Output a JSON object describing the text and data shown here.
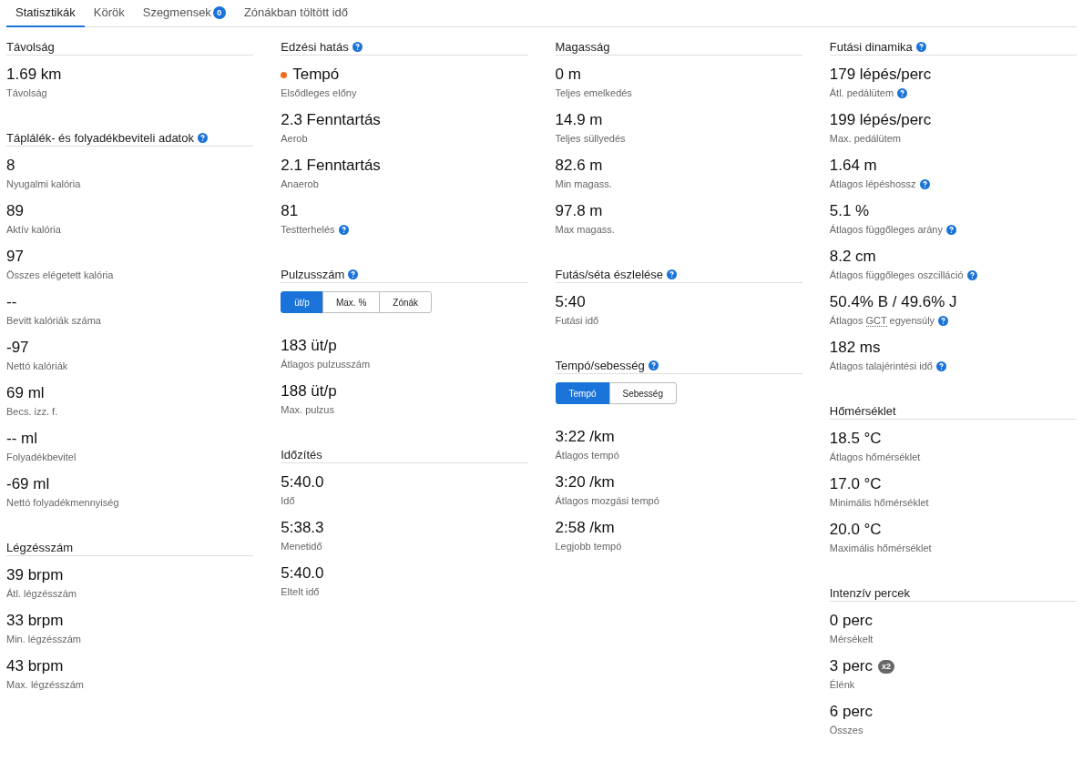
{
  "tabs": [
    {
      "label": "Statisztikák",
      "selected": true
    },
    {
      "label": "Körök",
      "selected": false
    },
    {
      "label": "Szegmensek",
      "selected": false,
      "badge": "0"
    },
    {
      "label": "Zónákban töltött idő",
      "selected": false
    }
  ],
  "columns": [
    [
      {
        "title": "Távolság",
        "stats": [
          {
            "value": "1.69 km",
            "label": "Távolság"
          }
        ]
      },
      {
        "title": "Táplálék- és folyadékbeviteli adatok",
        "help": true,
        "stats": [
          {
            "value": "8",
            "label": "Nyugalmi kalória"
          },
          {
            "value": "89",
            "label": "Aktív kalória"
          },
          {
            "value": "97",
            "label": "Összes elégetett kalória"
          },
          {
            "value": "--",
            "label": "Bevitt kalóriák száma"
          },
          {
            "value": "-97",
            "label": "Nettó kalóriák"
          },
          {
            "value": "69 ml",
            "label": "Becs. izz. f."
          },
          {
            "value": "-- ml",
            "label": "Folyadékbevitel"
          },
          {
            "value": "-69 ml",
            "label": "Nettó folyadékmennyiség"
          }
        ]
      },
      {
        "title": "Légzésszám",
        "stats": [
          {
            "value": "39 brpm",
            "label": "Átl. légzésszám"
          },
          {
            "value": "33 brpm",
            "label": "Min. légzésszám"
          },
          {
            "value": "43 brpm",
            "label": "Max. légzésszám"
          }
        ]
      }
    ],
    [
      {
        "title": "Edzési hatás",
        "help": true,
        "stats": [
          {
            "value": "Tempó",
            "label": "Elsődleges előny",
            "color": "#f26b1d"
          },
          {
            "value": "2.3 Fenntartás",
            "label": "Aerob"
          },
          {
            "value": "2.1 Fenntartás",
            "label": "Anaerob"
          },
          {
            "value": "81",
            "label": "Testterhelés",
            "help": true
          }
        ]
      },
      {
        "title": "Pulzusszám",
        "help": true,
        "toggle": [
          {
            "label": "üt/p",
            "selected": true
          },
          {
            "label": "Max. %",
            "selected": false
          },
          {
            "label": "Zónák",
            "selected": false
          }
        ],
        "stats": [
          {
            "value": "183 üt/p",
            "label": "Átlagos pulzusszám"
          },
          {
            "value": "188 üt/p",
            "label": "Max. pulzus"
          }
        ]
      },
      {
        "title": "Időzítés",
        "stats": [
          {
            "value": "5:40.0",
            "label": "Idő"
          },
          {
            "value": "5:38.3",
            "label": "Menetidő"
          },
          {
            "value": "5:40.0",
            "label": "Eltelt idő"
          }
        ]
      }
    ],
    [
      {
        "title": "Magasság",
        "stats": [
          {
            "value": "0 m",
            "label": "Teljes emelkedés"
          },
          {
            "value": "14.9 m",
            "label": "Teljes süllyedés"
          },
          {
            "value": "82.6 m",
            "label": "Min magass."
          },
          {
            "value": "97.8 m",
            "label": "Max magass."
          }
        ]
      },
      {
        "title": "Futás/séta észlelése",
        "help": true,
        "stats": [
          {
            "value": "5:40",
            "label": "Futási idő"
          }
        ]
      },
      {
        "title": "Tempó/sebesség",
        "help": true,
        "toggle": [
          {
            "label": "Tempó",
            "selected": true
          },
          {
            "label": "Sebesség",
            "selected": false
          }
        ],
        "stats": [
          {
            "value": "3:22 /km",
            "label": "Átlagos tempó"
          },
          {
            "value": "3:20 /km",
            "label": "Átlagos mozgási tempó"
          },
          {
            "value": "2:58 /km",
            "label": "Legjobb tempó"
          }
        ]
      }
    ],
    [
      {
        "title": "Futási dinamika",
        "help": true,
        "stats": [
          {
            "value": "179 lépés/perc",
            "label": "Átl. pedálütem",
            "help": true
          },
          {
            "value": "199 lépés/perc",
            "label": "Max. pedálütem"
          },
          {
            "value": "1.64 m",
            "label": "Átlagos lépéshossz",
            "help": true
          },
          {
            "value": "5.1 %",
            "label": "Átlagos függőleges arány",
            "help": true
          },
          {
            "value": "8.2 cm",
            "label": "Átlagos függőleges oszcilláció",
            "help": true
          },
          {
            "value": "50.4% B / 49.6% J",
            "label_parts": [
              {
                "text": "Átlagos "
              },
              {
                "text": "GCT",
                "abbr": true
              },
              {
                "text": " egyensúly"
              }
            ],
            "help": true
          },
          {
            "value": "182 ms",
            "label": "Átlagos talajérintési idő",
            "help": true
          }
        ]
      },
      {
        "title": "Hőmérséklet",
        "stats": [
          {
            "value": "18.5 °C",
            "label": "Átlagos hőmérséklet"
          },
          {
            "value": "17.0 °C",
            "label": "Minimális hőmérséklet"
          },
          {
            "value": "20.0 °C",
            "label": "Maximális hőmérséklet"
          }
        ]
      },
      {
        "title": "Intenzív percek",
        "stats": [
          {
            "value": "0 perc",
            "label": "Mérsékelt"
          },
          {
            "value": "3 perc",
            "label": "Élénk",
            "badge": "x2"
          },
          {
            "value": "6 perc",
            "label": "Összes"
          }
        ]
      }
    ]
  ]
}
